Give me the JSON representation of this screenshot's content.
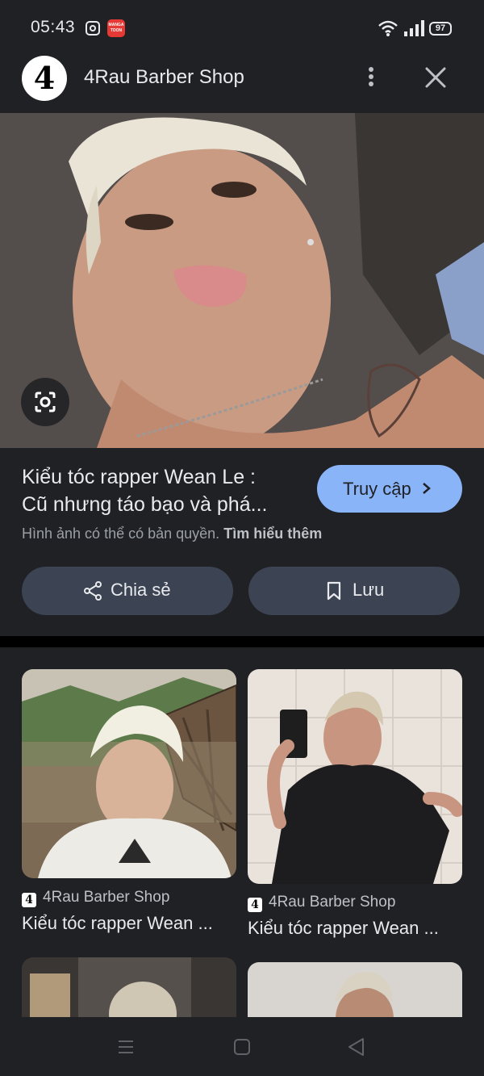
{
  "status_bar": {
    "time": "05:43",
    "manga_badge": "MANGA TOON",
    "battery": "97"
  },
  "header": {
    "logo_text": "4",
    "site_name": "4Rau Barber Shop"
  },
  "image_info": {
    "title_line1": "Kiểu tóc rapper Wean Le :",
    "title_line2": "Cũ nhưng táo bạo và phá...",
    "visit_label": "Truy cập",
    "copyright_text": "Hình ảnh có thể có bản quyền.",
    "learn_more": "Tìm hiểu thêm"
  },
  "actions": {
    "share_label": "Chia sẻ",
    "save_label": "Lưu"
  },
  "related": [
    {
      "source": "4Rau Barber Shop",
      "caption": "Kiểu tóc rapper Wean ..."
    },
    {
      "source": "4Rau Barber Shop",
      "caption": "Kiểu tóc rapper Wean ..."
    }
  ],
  "colors": {
    "background": "#202124",
    "accent": "#8ab4f8",
    "button_bg": "#3c4453"
  }
}
